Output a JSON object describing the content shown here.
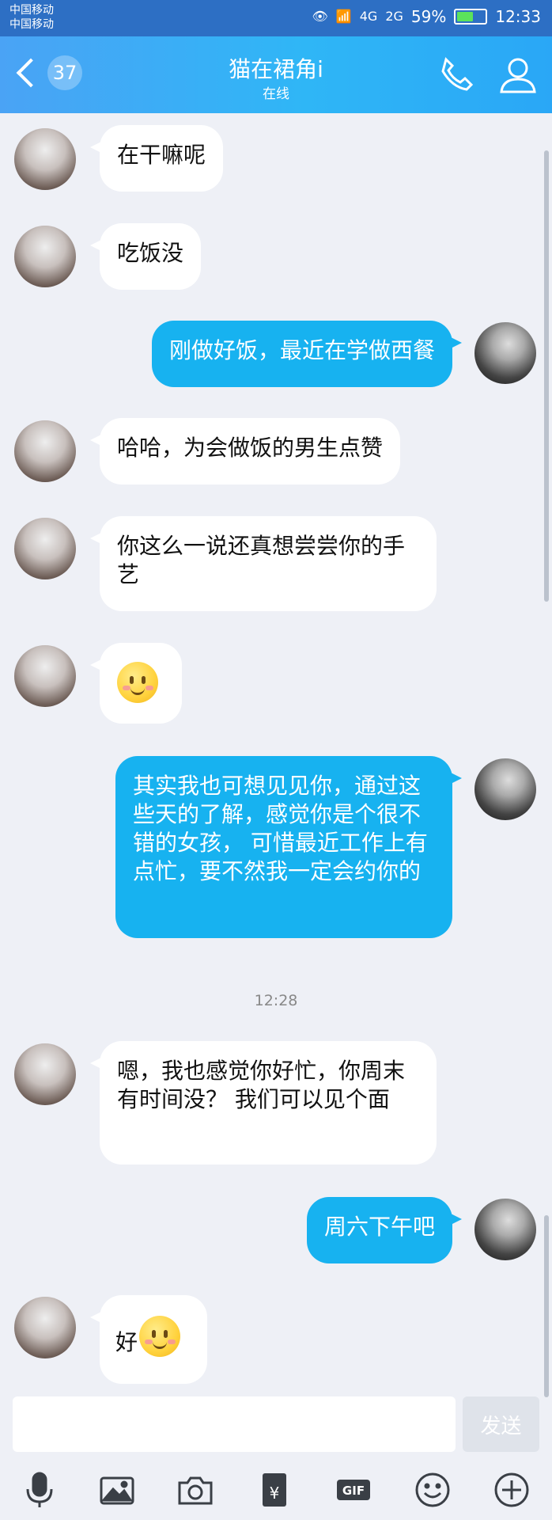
{
  "status_bar": {
    "carrier1": "中国移动",
    "carrier2": "中国移动",
    "signal4g": "4G",
    "signal2g": "2G",
    "battery": "59%",
    "battery_level": 0.59,
    "time": "12:33"
  },
  "header": {
    "unread_count": "37",
    "contact_name": "猫在裙角i",
    "contact_status": "在线"
  },
  "messages": [
    {
      "side": "left",
      "text": "在干嘛呢"
    },
    {
      "side": "left",
      "text": "吃饭没"
    },
    {
      "side": "right",
      "text": "刚做好饭，最近在学做西餐"
    },
    {
      "side": "left",
      "text": "哈哈，为会做饭的男生点赞"
    },
    {
      "side": "left",
      "text": "你这么一说还真想尝尝你的手艺"
    },
    {
      "side": "left",
      "emoji": "smile-emoji"
    },
    {
      "side": "right",
      "text": "其实我也可想见见你，通过这些天的了解，感觉你是个很不错的女孩， 可惜最近工作上有点忙，要不然我一定会约你的"
    },
    {
      "side": "left",
      "text": "嗯，我也感觉你好忙，你周末有时间没？ 我们可以见个面"
    },
    {
      "side": "right",
      "text": "周六下午吧"
    },
    {
      "side": "left",
      "text": "好",
      "emoji": "smile-emoji"
    }
  ],
  "timestamp": "12:28",
  "input": {
    "placeholder": "",
    "send_label": "发送"
  },
  "toolbar": {
    "gif_label": "GIF"
  },
  "colors": {
    "header": "#2fb6f6",
    "outgoing_bubble": "#17b2f0",
    "incoming_bubble": "#ffffff",
    "background": "#eef0f6"
  }
}
